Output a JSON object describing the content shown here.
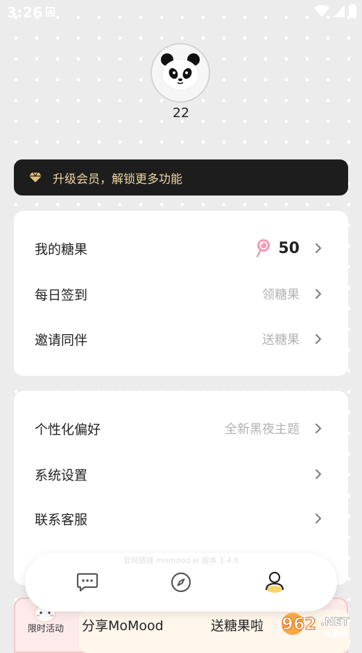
{
  "status_bar": {
    "time": "3:26",
    "indicator": "A"
  },
  "profile": {
    "username": "22"
  },
  "vip_banner": {
    "text": "升级会员，解锁更多功能",
    "accent_color": "#f0d7a4"
  },
  "card1": {
    "rows": [
      {
        "label": "我的糖果",
        "value": "50"
      },
      {
        "label": "每日签到",
        "value": "领糖果"
      },
      {
        "label": "邀请同伴",
        "value": "送糖果"
      }
    ]
  },
  "card2": {
    "rows": [
      {
        "label": "个性化偏好",
        "value": "全新黑夜主题"
      },
      {
        "label": "系统设置",
        "value": ""
      },
      {
        "label": "联系客服",
        "value": ""
      }
    ]
  },
  "footer_faint": "官网链接 momood.ai  版本 1.4.6",
  "promo": {
    "tag": "限时活动",
    "item1": "分享MoMood",
    "item2": "送糖果啦"
  },
  "tabs": [
    {
      "name": "chat",
      "icon": "chat-icon"
    },
    {
      "name": "discover",
      "icon": "compass-icon"
    },
    {
      "name": "me",
      "icon": "user-icon",
      "active": true
    }
  ],
  "watermark": {
    "main": "962",
    "suffix": ".NET",
    "sub": "乐游网"
  }
}
